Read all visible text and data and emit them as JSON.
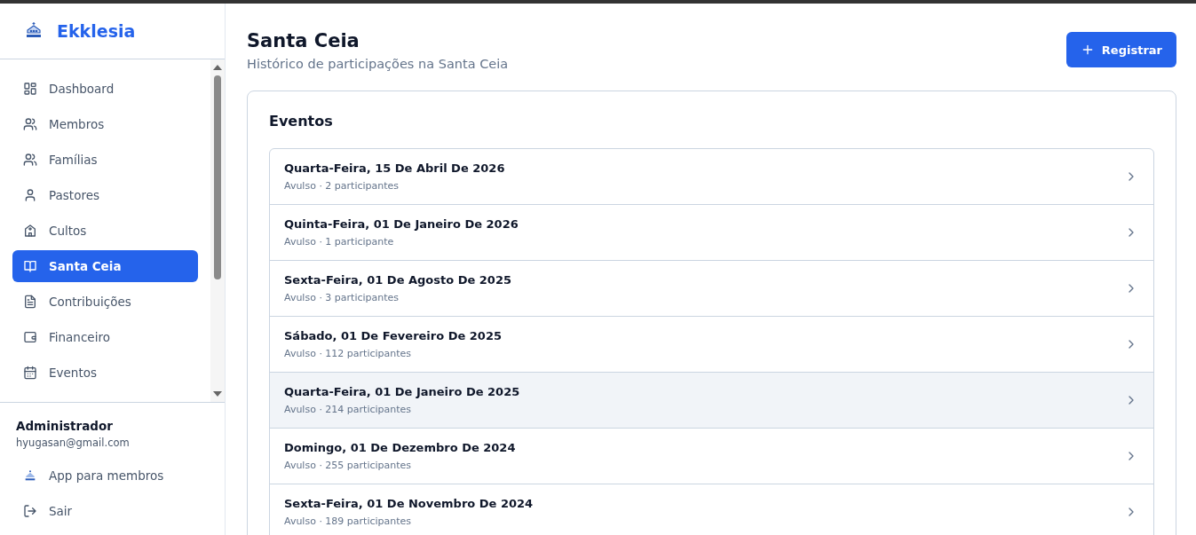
{
  "brand": {
    "name": "Ekklesia"
  },
  "sidebar": {
    "items": [
      {
        "label": "Dashboard",
        "selected": false
      },
      {
        "label": "Membros",
        "selected": false
      },
      {
        "label": "Famílias",
        "selected": false
      },
      {
        "label": "Pastores",
        "selected": false
      },
      {
        "label": "Cultos",
        "selected": false
      },
      {
        "label": "Santa Ceia",
        "selected": true
      },
      {
        "label": "Contribuições",
        "selected": false
      },
      {
        "label": "Financeiro",
        "selected": false
      },
      {
        "label": "Eventos",
        "selected": false
      }
    ],
    "user": {
      "name": "Administrador",
      "email": "hyugasan@gmail.com"
    },
    "footer_links": [
      "App para membros",
      "Sair"
    ]
  },
  "page": {
    "title": "Santa Ceia",
    "subtitle": "Histórico de participações na Santa Ceia",
    "action": "Registrar"
  },
  "events": {
    "title": "Eventos",
    "rows": [
      {
        "date": "Quarta-Feira, 15 De Abril De 2026",
        "detail": "Avulso · 2 participantes",
        "hovered": false
      },
      {
        "date": "Quinta-Feira, 01 De Janeiro De 2026",
        "detail": "Avulso · 1 participante",
        "hovered": false
      },
      {
        "date": "Sexta-Feira, 01 De Agosto De 2025",
        "detail": "Avulso · 3 participantes",
        "hovered": false
      },
      {
        "date": "Sábado, 01 De Fevereiro De 2025",
        "detail": "Avulso · 112 participantes",
        "hovered": false
      },
      {
        "date": "Quarta-Feira, 01 De Janeiro De 2025",
        "detail": "Avulso · 214 participantes",
        "hovered": true
      },
      {
        "date": "Domingo, 01 De Dezembro De 2024",
        "detail": "Avulso · 255 participantes",
        "hovered": false
      },
      {
        "date": "Sexta-Feira, 01 De Novembro De 2024",
        "detail": "Avulso · 189 participantes",
        "hovered": false
      }
    ]
  }
}
